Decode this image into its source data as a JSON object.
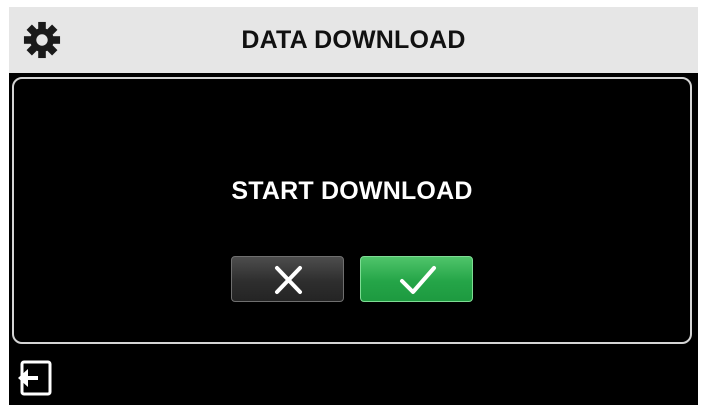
{
  "header": {
    "title": "DATA DOWNLOAD",
    "settings_icon": "gear-icon"
  },
  "dialog": {
    "prompt": "START DOWNLOAD",
    "cancel_icon": "close-icon",
    "confirm_icon": "checkmark-icon"
  },
  "footer": {
    "back_icon": "exit-arrow-icon"
  },
  "colors": {
    "header_bg": "#e6e6e6",
    "screen_bg": "#000000",
    "confirm_green": "#25a548",
    "cancel_dark": "#2e2e2e"
  }
}
